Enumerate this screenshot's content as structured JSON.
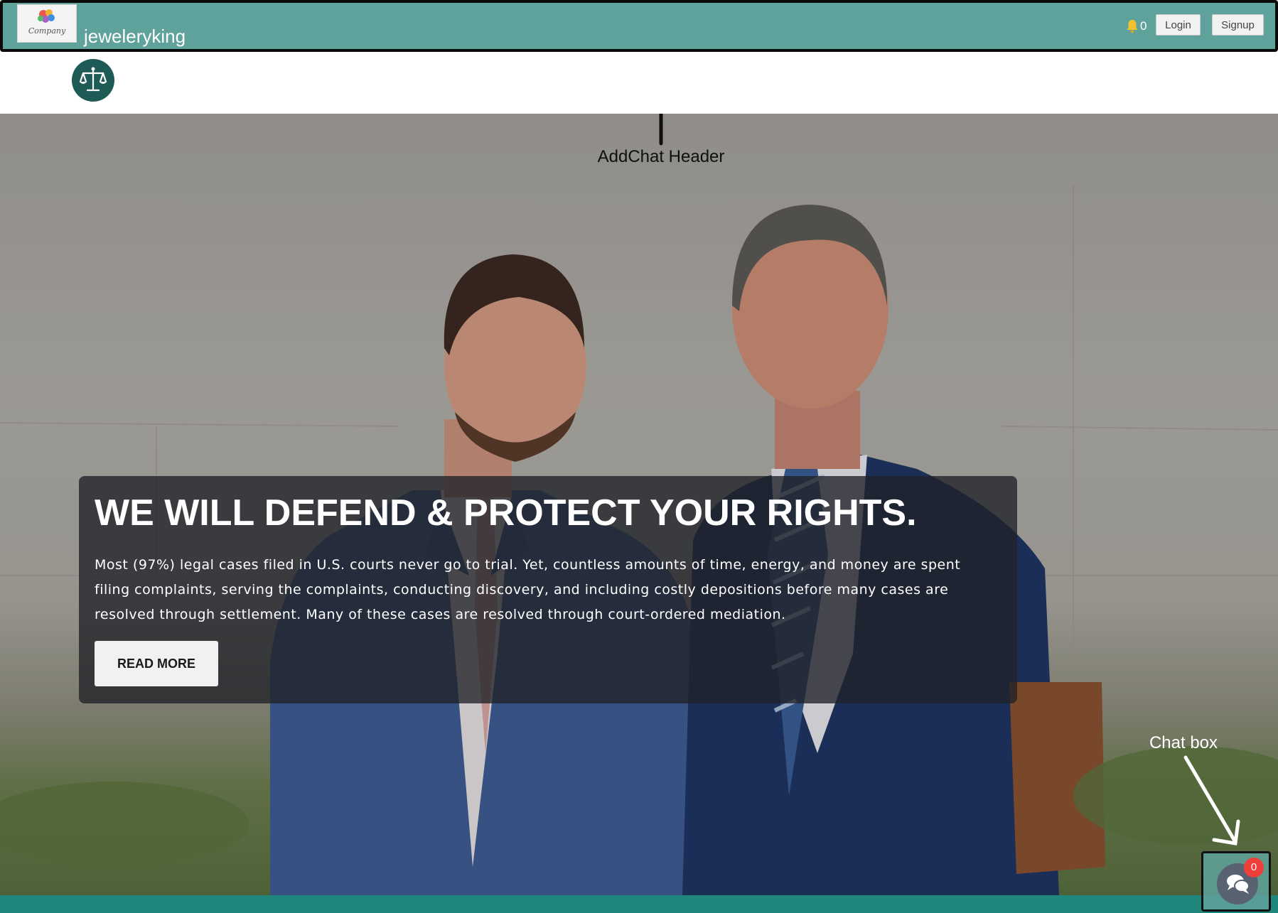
{
  "addchat_header": {
    "logo_text": "Company",
    "brand_name": "jeweleryking",
    "notification_icon": "bell-icon",
    "notification_count": "0",
    "login_label": "Login",
    "signup_label": "Signup",
    "bar_color": "#5fa29c"
  },
  "site_header": {
    "logo_icon": "scales-of-justice-icon"
  },
  "annotations": {
    "addchat_header": "AddChat Header",
    "chat_box": "Chat box"
  },
  "hero": {
    "title": "WE WILL DEFEND & PROTECT YOUR RIGHTS.",
    "text": "Most (97%) legal cases filed in U.S. courts never go to trial. Yet, countless amounts of time, energy, and money are spent filing complaints, serving the complaints, conducting discovery, and including costly depositions before many cases are resolved through settlement. Many of these cases are resolved through court-ordered mediation.",
    "cta_label": "READ MORE"
  },
  "chat_widget": {
    "icon": "chat-bubbles-icon",
    "unread_count": "0",
    "badge_color": "#ee3f3b"
  },
  "footer": {
    "bar_color": "#21877c"
  }
}
